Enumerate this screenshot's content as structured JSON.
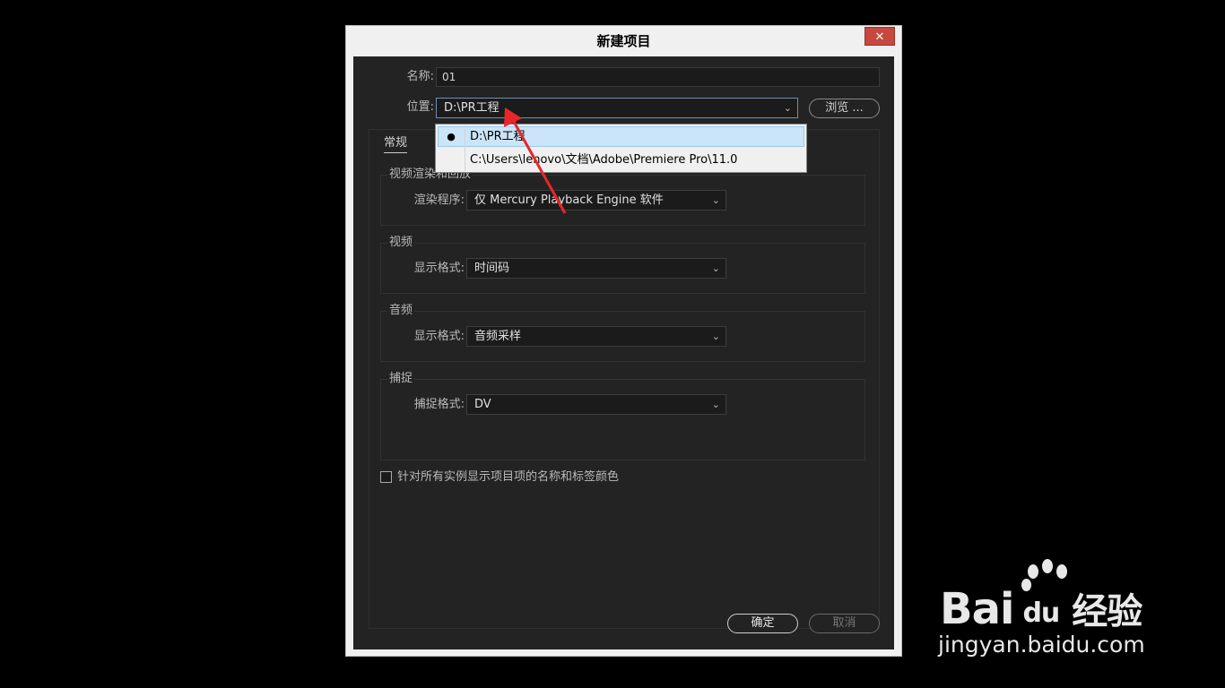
{
  "window": {
    "title": "新建项目",
    "close_glyph": "✕"
  },
  "form": {
    "name_label": "名称:",
    "name_value": "01",
    "location_label": "位置:",
    "location_value": "D:\\PR工程",
    "browse_button": "浏览 ..."
  },
  "location_dropdown": {
    "items": [
      {
        "label": "D:\\PR工程",
        "selected": true,
        "bullet": "●"
      },
      {
        "label": "C:\\Users\\lenovo\\文档\\Adobe\\Premiere Pro\\11.0",
        "selected": false,
        "bullet": ""
      }
    ]
  },
  "tabs": {
    "general": "常规"
  },
  "render_group": {
    "title": "视频渲染和回放",
    "renderer_label": "渲染程序:",
    "renderer_value": "仅 Mercury Playback Engine 软件"
  },
  "video_group": {
    "title": "视频",
    "format_label": "显示格式:",
    "format_value": "时间码"
  },
  "audio_group": {
    "title": "音频",
    "format_label": "显示格式:",
    "format_value": "音频采样"
  },
  "capture_group": {
    "title": "捕捉",
    "format_label": "捕捉格式:",
    "format_value": "DV"
  },
  "checkbox": {
    "label": "针对所有实例显示项目项的名称和标签颜色",
    "checked": false
  },
  "footer": {
    "ok": "确定",
    "cancel": "取消"
  },
  "watermark": {
    "logo_text": "Bai",
    "logo_du": "du",
    "logo_cn": "经验",
    "url": "jingyan.baidu.com"
  },
  "colors": {
    "annotation_arrow": "#e8262a",
    "close_button": "#c7483f",
    "dropdown_highlight": "#cce4f7"
  }
}
